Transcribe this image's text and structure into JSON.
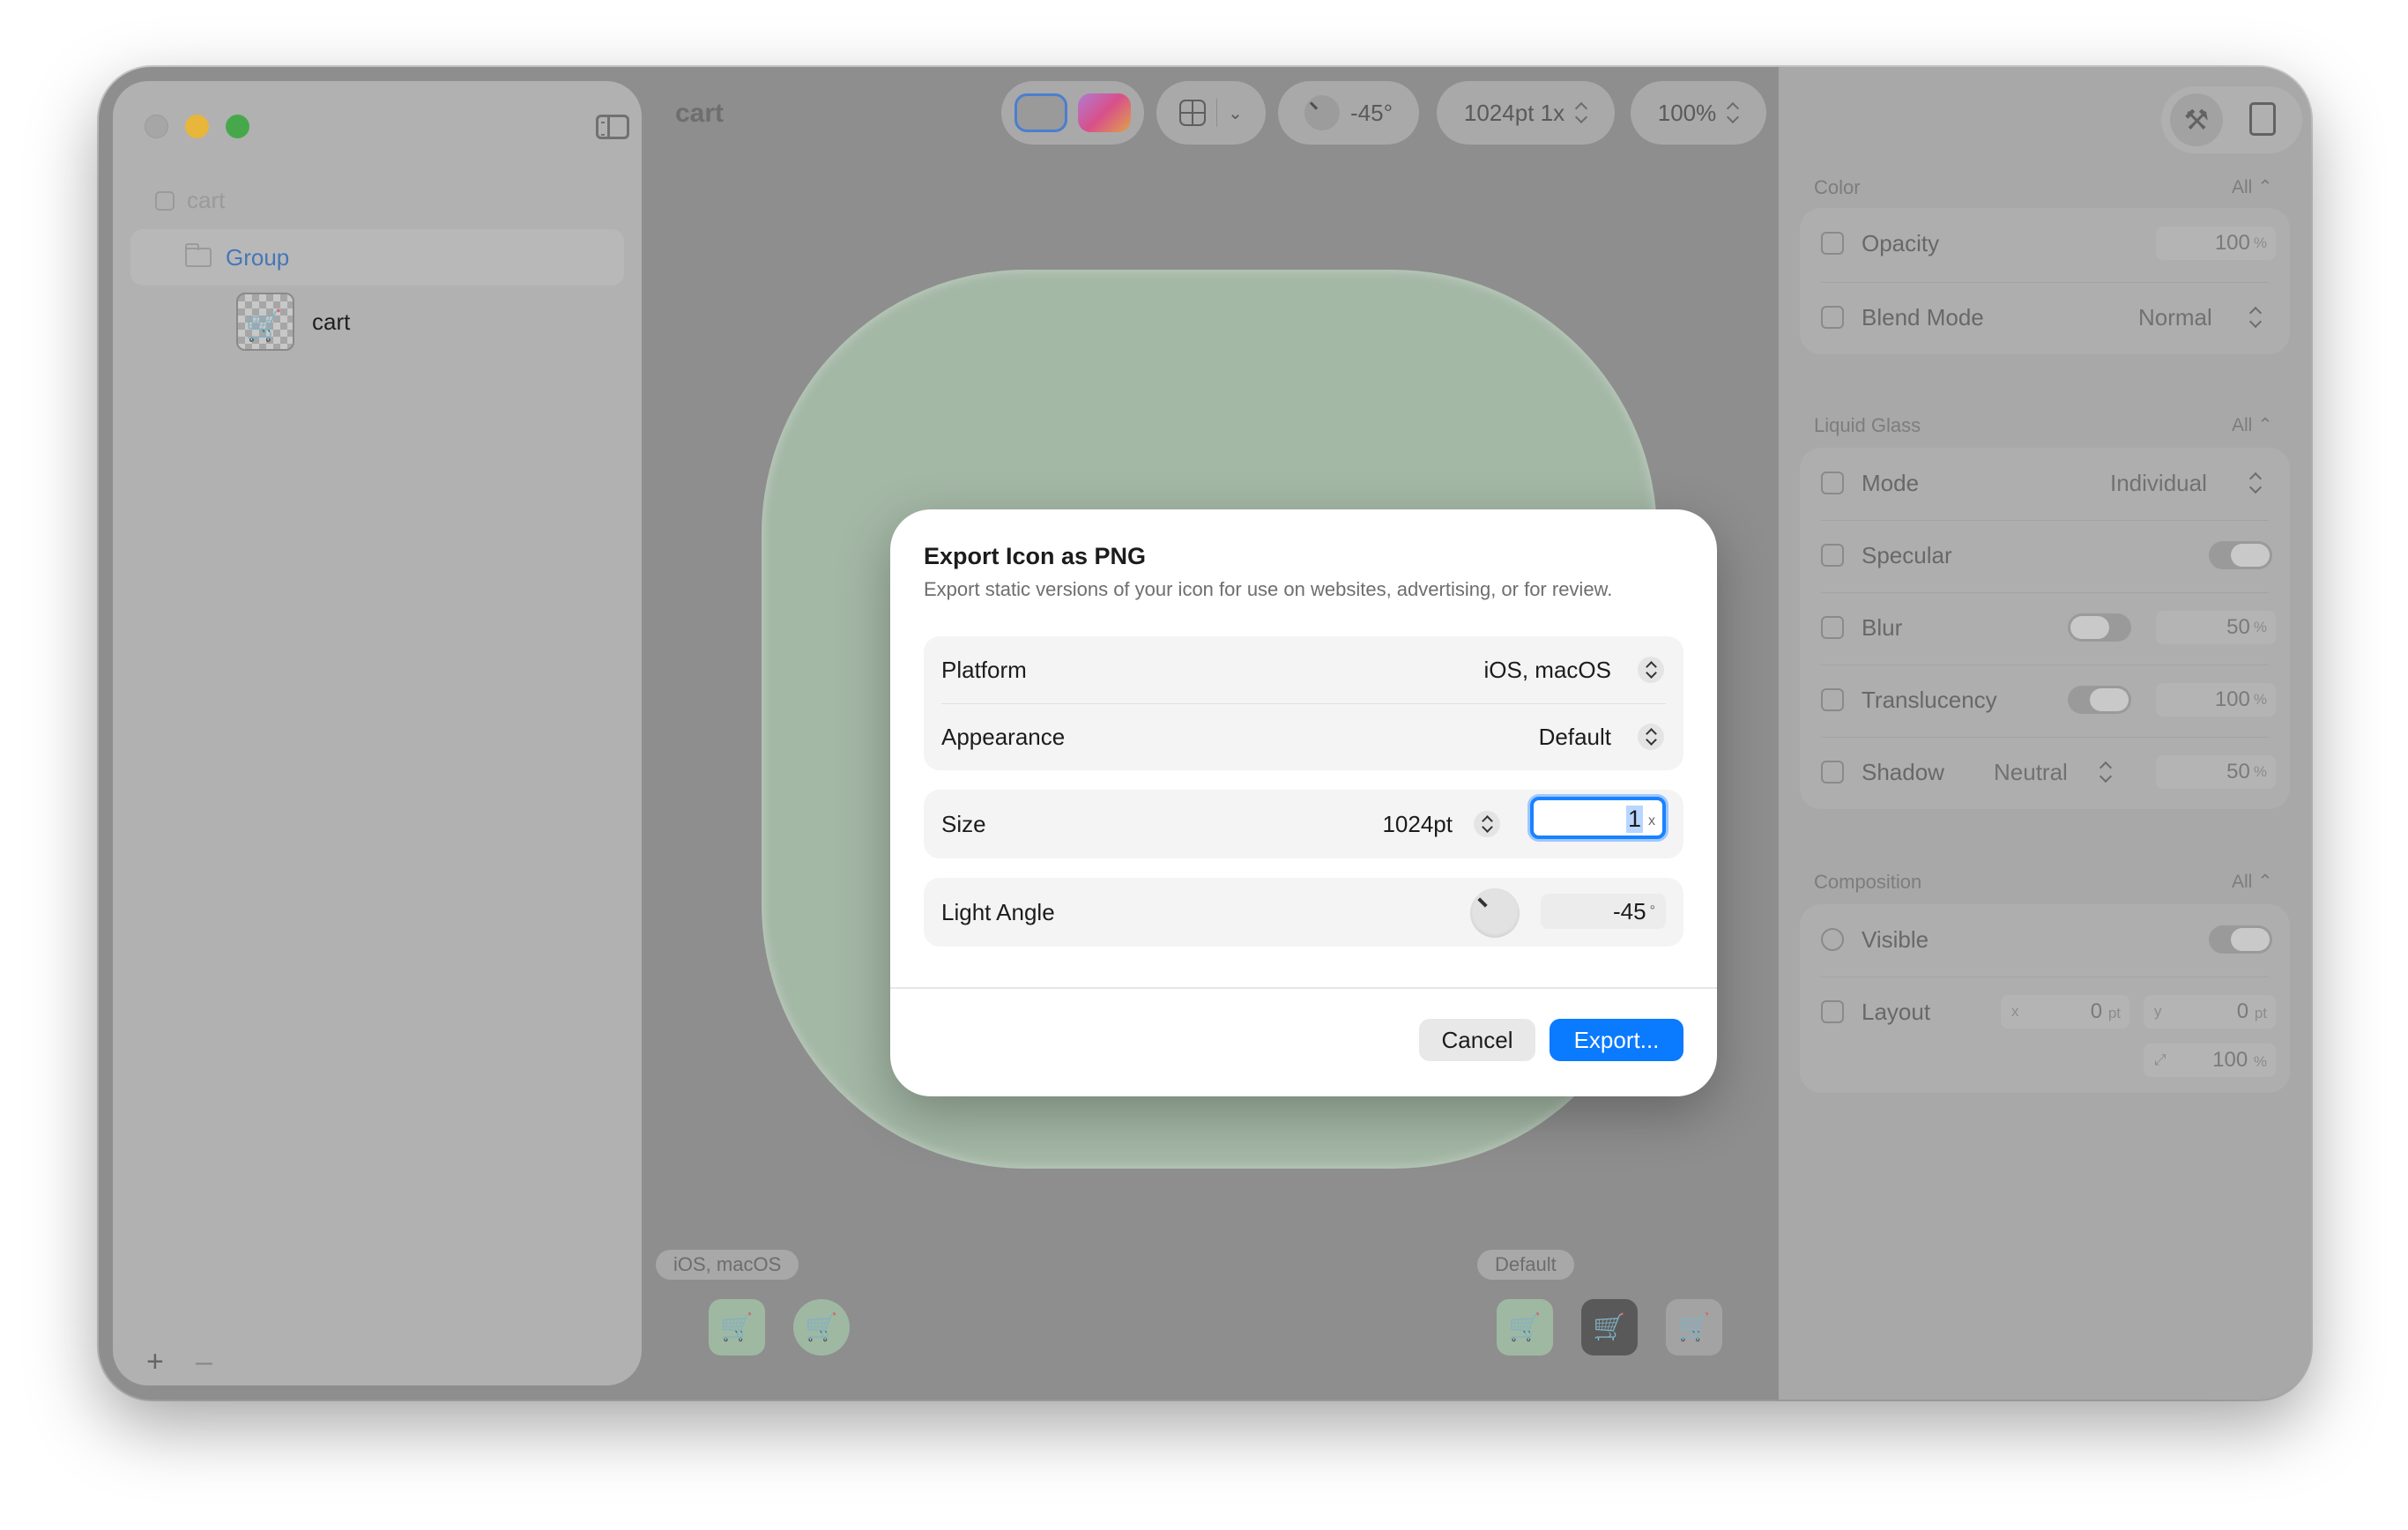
{
  "sidebar": {
    "root_label": "cart",
    "group_label": "Group",
    "leaf_label": "cart",
    "add_label": "+",
    "remove_label": "–"
  },
  "toolbar": {
    "document_title": "cart",
    "light_angle": "-45°",
    "size_label": "1024pt 1x",
    "zoom_label": "100%"
  },
  "canvas": {
    "platform_tag": "iOS, macOS",
    "appearance_tag": "Default",
    "icon_color": "#a4b8a6"
  },
  "inspector": {
    "color": {
      "title": "Color",
      "all_label": "All ⌃",
      "opacity_label": "Opacity",
      "opacity_value": "100",
      "opacity_unit": "%",
      "blend_label": "Blend Mode",
      "blend_value": "Normal"
    },
    "liquid_glass": {
      "title": "Liquid Glass",
      "all_label": "All ⌃",
      "mode_label": "Mode",
      "mode_value": "Individual",
      "specular_label": "Specular",
      "blur_label": "Blur",
      "blur_value": "50",
      "translucency_label": "Translucency",
      "translucency_value": "100",
      "shadow_label": "Shadow",
      "shadow_mode": "Neutral",
      "shadow_value": "50",
      "unit": "%"
    },
    "composition": {
      "title": "Composition",
      "all_label": "All ⌃",
      "visible_label": "Visible",
      "layout_label": "Layout",
      "x_label": "x",
      "x_value": "0",
      "y_label": "y",
      "y_value": "0",
      "pt_unit": "pt",
      "scale_value": "100",
      "scale_unit": "%"
    }
  },
  "dialog": {
    "title": "Export Icon as PNG",
    "subtitle": "Export static versions of your icon for use on websites, advertising, or for review.",
    "platform_label": "Platform",
    "platform_value": "iOS, macOS",
    "appearance_label": "Appearance",
    "appearance_value": "Default",
    "size_label": "Size",
    "size_value": "1024pt",
    "scale_value": "1",
    "scale_unit": "x",
    "light_angle_label": "Light Angle",
    "light_angle_value": "-45",
    "light_angle_unit": "°",
    "cancel_label": "Cancel",
    "export_label": "Export..."
  }
}
